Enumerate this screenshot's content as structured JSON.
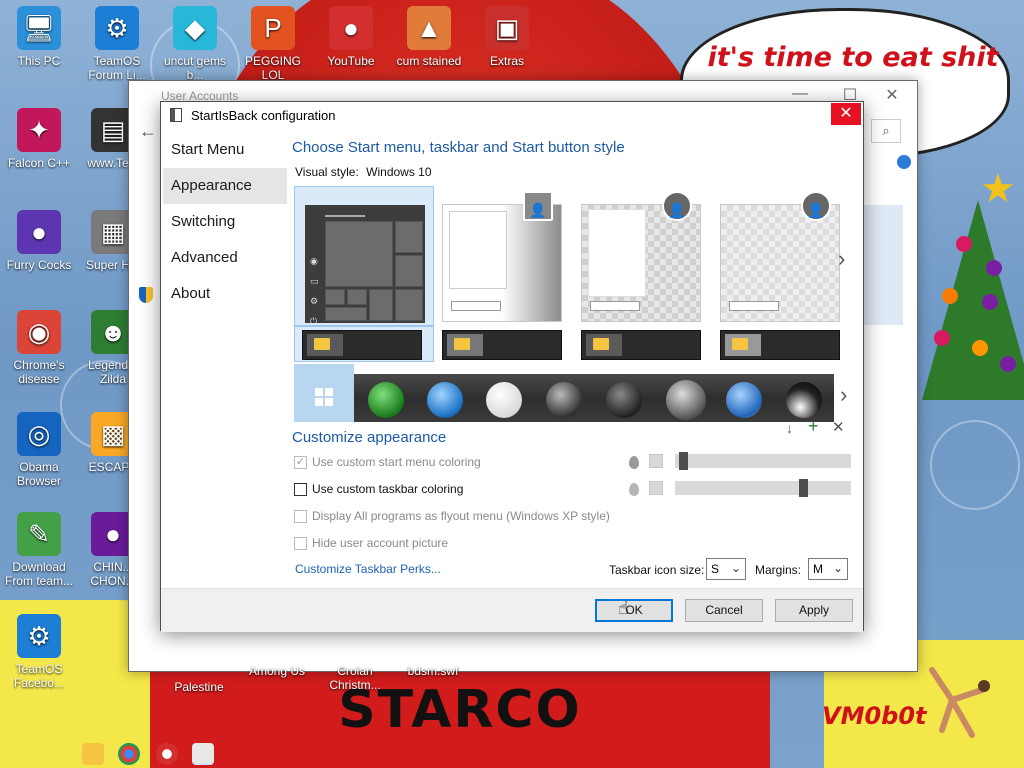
{
  "desktop": {
    "icons": [
      {
        "label": "This PC",
        "icon": "pc-icon",
        "color": "#2b8fd9",
        "glyph": "🖥"
      },
      {
        "label": "TeamOS Forum Li...",
        "icon": "gear-icon",
        "color": "#1d7ed6",
        "glyph": "⚙"
      },
      {
        "label": "uncut gems b...",
        "icon": "diamond-icon",
        "color": "#27b8d9",
        "glyph": "◆"
      },
      {
        "label": "PEGGING LOL",
        "icon": "peggle-icon",
        "color": "#e2531f",
        "glyph": "P"
      },
      {
        "label": "YouTube",
        "icon": "angry-bird-icon",
        "color": "#d32f2f",
        "glyph": "●"
      },
      {
        "label": "cum stained",
        "icon": "cake-icon",
        "color": "#e07b39",
        "glyph": "▲"
      },
      {
        "label": "Extras",
        "icon": "gift-icon",
        "color": "#c9302c",
        "glyph": "▣"
      },
      {
        "label": "Falcon C++",
        "icon": "falcon-icon",
        "color": "#c2185b",
        "glyph": "✦"
      },
      {
        "label": "www.Te...",
        "icon": "shortcut-icon",
        "color": "#333333",
        "glyph": "▤"
      },
      {
        "label": "Furry Cocks",
        "icon": "ball-icon",
        "color": "#5e35b1",
        "glyph": "●"
      },
      {
        "label": "Super H...",
        "icon": "pixel-icon",
        "color": "#7a7a7a",
        "glyph": "▦"
      },
      {
        "label": "Chrome's disease",
        "icon": "chrome-icon",
        "color": "#db4437",
        "glyph": "◉"
      },
      {
        "label": "Legend... Zilda",
        "icon": "game-icon",
        "color": "#2e7d32",
        "glyph": "☻"
      },
      {
        "label": "Obama Browser",
        "icon": "obama-icon",
        "color": "#1565c0",
        "glyph": "◎"
      },
      {
        "label": "ESCAPE",
        "icon": "escape-icon",
        "color": "#f9a825",
        "glyph": "▩"
      },
      {
        "label": "Download From team...",
        "icon": "notepad-icon",
        "color": "#43a047",
        "glyph": "✎"
      },
      {
        "label": "CHIN... CHON...",
        "icon": "chin-icon",
        "color": "#6a1b9a",
        "glyph": "●"
      },
      {
        "label": "TeamOS Facebo...",
        "icon": "gear-icon",
        "color": "#1d7ed6",
        "glyph": "⚙"
      }
    ],
    "bottom_labels": [
      "Palestine",
      "Among Us",
      "Crolan Christm...",
      "bdsm.swf"
    ],
    "speech_text": "it's time to eat shit ... ew",
    "hat_text": "STARCO",
    "signature": "VM0b0t"
  },
  "background_window": {
    "title": "User Accounts",
    "min": "—",
    "max": "☐",
    "close": "✕"
  },
  "dialog": {
    "title": "StartIsBack configuration",
    "close_glyph": "✕",
    "nav": [
      "Start Menu",
      "Appearance",
      "Switching",
      "Advanced",
      "About"
    ],
    "selected_nav": 1,
    "heading": "Choose Start menu, taskbar and Start button style",
    "visual_style_label": "Visual style:",
    "visual_style_value": "Windows 10",
    "customize_heading": "Customize appearance",
    "options": [
      {
        "label": "Use custom start menu coloring",
        "checked": true,
        "disabled": true
      },
      {
        "label": "Use custom taskbar coloring",
        "checked": false,
        "disabled": false
      },
      {
        "label": "Display All programs as flyout menu (Windows XP style)",
        "checked": false,
        "disabled": true
      },
      {
        "label": "Hide user account picture",
        "checked": false,
        "disabled": true
      }
    ],
    "perks_link": "Customize Taskbar Perks...",
    "icon_size_label": "Taskbar icon size:",
    "icon_size_value": "S",
    "margins_label": "Margins:",
    "margins_value": "M",
    "buttons": {
      "ok": "OK",
      "cancel": "Cancel",
      "apply": "Apply"
    },
    "sliders": [
      0.0,
      0.75
    ]
  },
  "colors": {
    "accent": "#1d5aa3",
    "link": "#1d63b1",
    "close": "#e81123",
    "selection": "#dbeaf8"
  }
}
